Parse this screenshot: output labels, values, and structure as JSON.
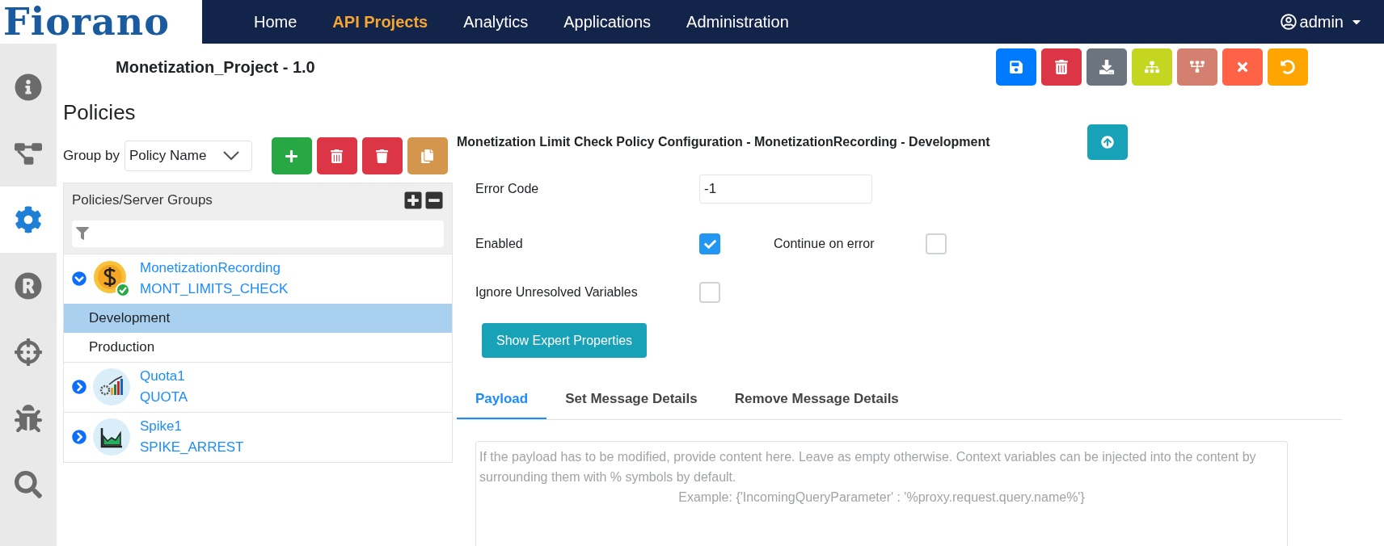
{
  "header": {
    "logo": "Fiorano",
    "nav": [
      {
        "label": "Home",
        "selected": false
      },
      {
        "label": "API Projects",
        "selected": true
      },
      {
        "label": "Analytics",
        "selected": false
      },
      {
        "label": "Applications",
        "selected": false
      },
      {
        "label": "Administration",
        "selected": false
      }
    ],
    "user": "admin"
  },
  "sidebar": {
    "items": [
      {
        "kind": "info",
        "selected": false
      },
      {
        "kind": "flow",
        "selected": false
      },
      {
        "kind": "settings",
        "selected": true
      },
      {
        "kind": "registered",
        "selected": false
      },
      {
        "kind": "crosshair",
        "selected": false
      },
      {
        "kind": "bug",
        "selected": false
      },
      {
        "kind": "search",
        "selected": false
      }
    ]
  },
  "project_title": "Monetization_Project - 1.0",
  "toolbar": [
    {
      "kind": "save",
      "color": "#007bff"
    },
    {
      "kind": "delete",
      "color": "#dc3545"
    },
    {
      "kind": "download",
      "color": "#6c757d"
    },
    {
      "kind": "hierarchy",
      "color": "#c4d61f"
    },
    {
      "kind": "merge",
      "color": "#d38070"
    },
    {
      "kind": "close",
      "color": "#ff6347"
    },
    {
      "kind": "undo",
      "color": "#ffa500"
    }
  ],
  "policies": {
    "heading": "Policies",
    "group_by_label": "Group by",
    "group_by_value": "Policy Name",
    "actions": [
      {
        "kind": "add",
        "color": "#28a745"
      },
      {
        "kind": "delete",
        "color": "#dc3545"
      },
      {
        "kind": "delete-all",
        "color": "#dc3545"
      },
      {
        "kind": "copy",
        "color": "#d4964c"
      }
    ],
    "tree_header": "Policies/Server Groups",
    "tree": [
      {
        "name": "MonetizationRecording",
        "type": "MONT_LIMITS_CHECK",
        "kind": "money",
        "expanded": true,
        "children": [
          {
            "label": "Development",
            "selected": true
          },
          {
            "label": "Production",
            "selected": false
          }
        ]
      },
      {
        "name": "Quota1",
        "type": "QUOTA",
        "kind": "quota",
        "expanded": false
      },
      {
        "name": "Spike1",
        "type": "SPIKE_ARREST",
        "kind": "spike",
        "expanded": false
      }
    ]
  },
  "config": {
    "title": "Monetization Limit Check Policy Configuration - MonetizationRecording - Development",
    "error_code_label": "Error Code",
    "error_code_value": "-1",
    "enabled_label": "Enabled",
    "enabled": true,
    "continue_label": "Continue on error",
    "continue_on_error": false,
    "ignore_label": "Ignore Unresolved Variables",
    "ignore_unresolved": false,
    "expert_button": "Show Expert Properties",
    "tabs": [
      {
        "label": "Payload",
        "selected": true
      },
      {
        "label": "Set Message Details",
        "selected": false
      },
      {
        "label": "Remove Message Details",
        "selected": false
      }
    ],
    "payload_placeholder": "If the payload has to be modified, provide content here. Leave as empty otherwise. Context variables can be injected into the content by surrounding them with % symbols by default.",
    "payload_example": "Example: {'IncomingQueryParameter' : '%proxy.request.query.name%'}"
  }
}
